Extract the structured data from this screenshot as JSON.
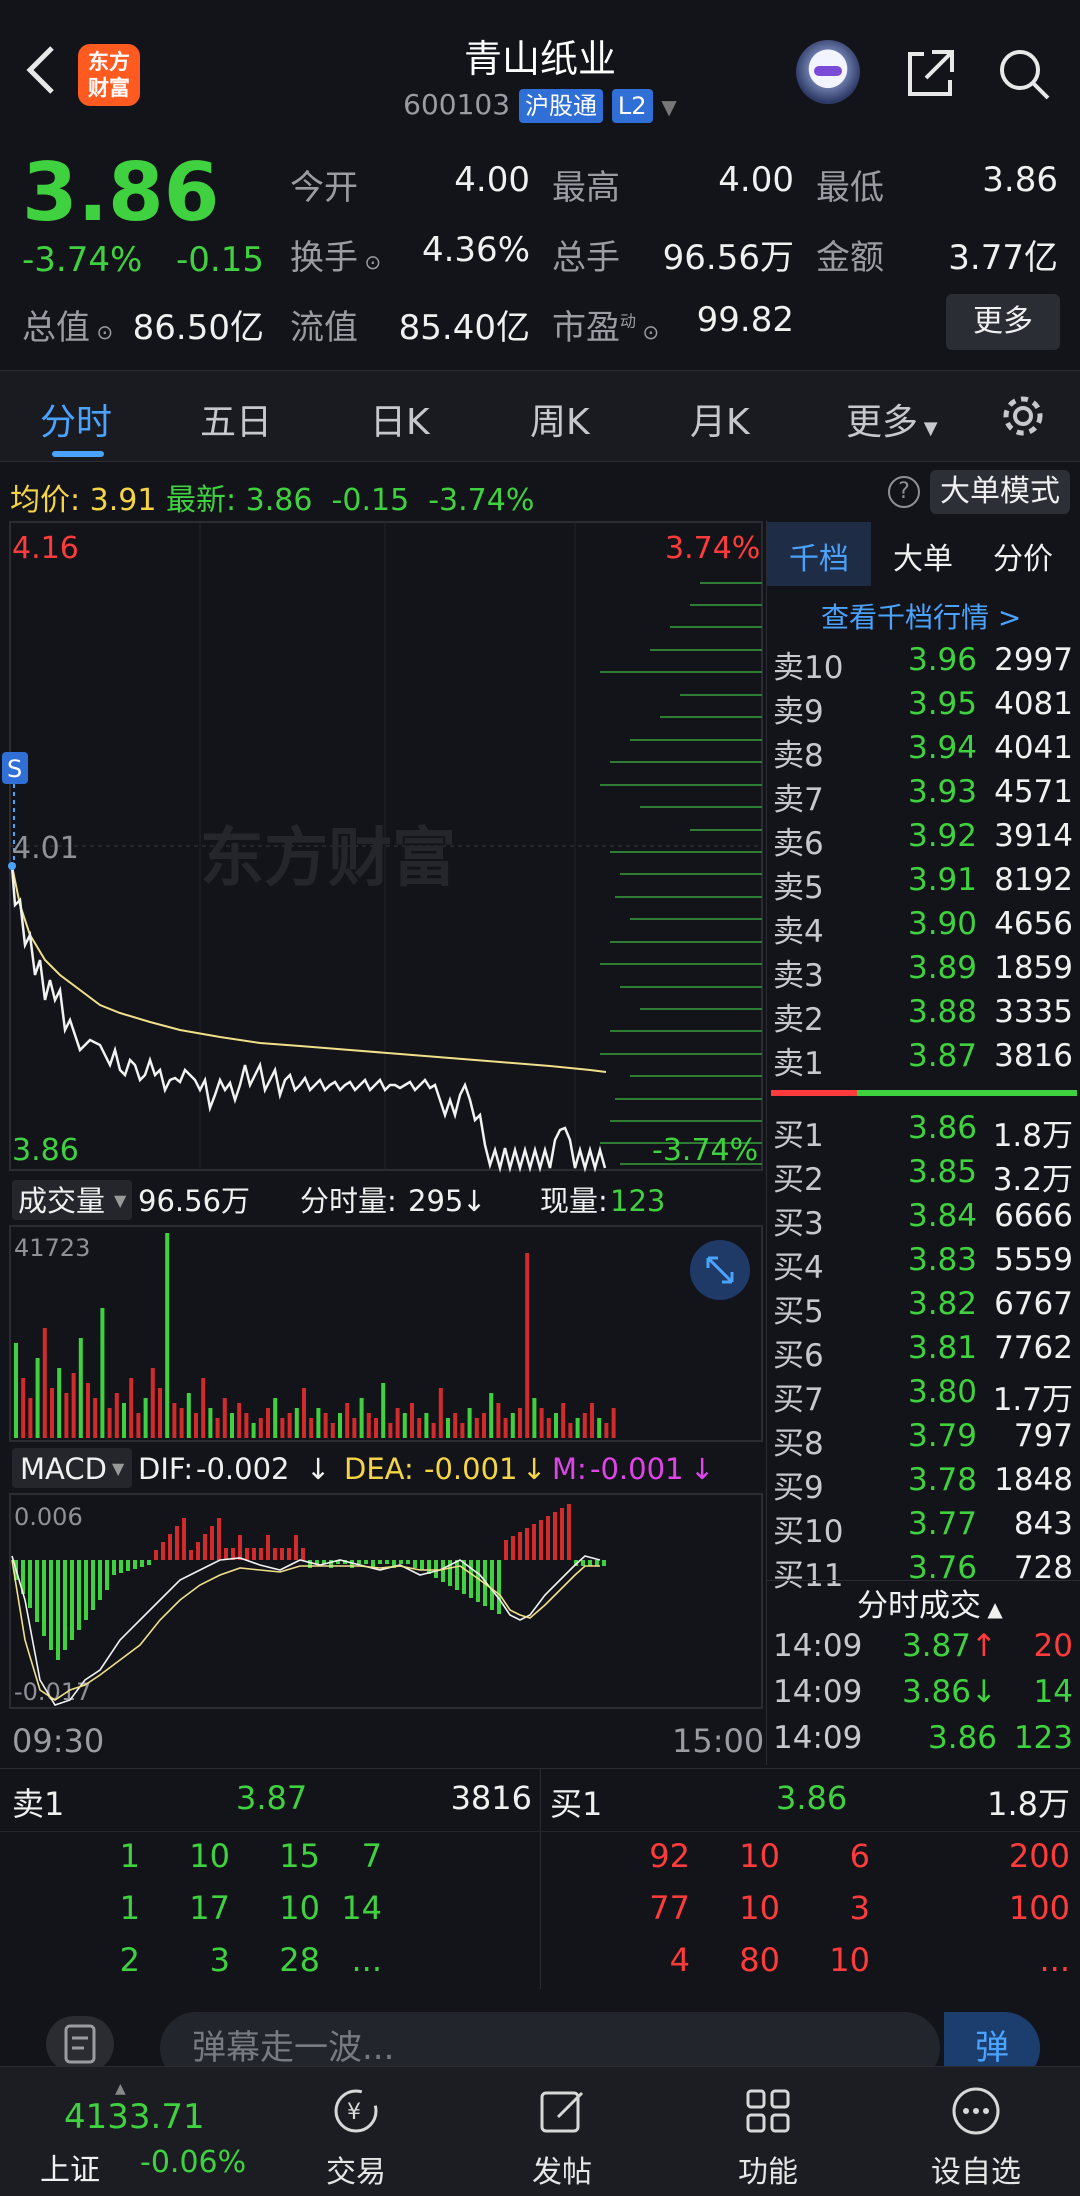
{
  "header": {
    "logo_text": "东方财富",
    "title": "青山纸业",
    "code": "600103",
    "tag_market": "沪股通",
    "tag_level": "L2"
  },
  "quote": {
    "price": "3.86",
    "change_pct": "-3.74%",
    "change": "-0.15",
    "rows": [
      {
        "l1": "今开",
        "v1": "4.00",
        "l2": "最高",
        "v2": "4.00",
        "l3": "最低",
        "v3": "3.86"
      },
      {
        "l1": "换手",
        "v1": "4.36%",
        "l2": "总手",
        "v2": "96.56万",
        "l3": "金额",
        "v3": "3.77亿"
      },
      {
        "l1": "总值",
        "v1": "86.50亿",
        "l2": "流值",
        "v2": "85.40亿",
        "l3": "市盈",
        "v3": "99.82"
      }
    ],
    "pe_sup": "动",
    "more_label": "更多"
  },
  "tabs": [
    "分时",
    "五日",
    "日K",
    "周K",
    "月K",
    "更多"
  ],
  "info": {
    "avg_label": "均价:",
    "avg": "3.91",
    "latest_label": "最新:",
    "latest": "3.86",
    "chg": "-0.15",
    "pct": "-3.74%",
    "mode_label": "大单模式"
  },
  "chart": {
    "hi": "4.16",
    "hi_pct": "3.74%",
    "mid": "4.01",
    "lo": "3.86",
    "lo_pct": "-3.74%",
    "watermark": "东方财富",
    "s_marker": "S",
    "vol_label": "成交量",
    "vol_total": "96.56万",
    "tick_vol_label": "分时量:",
    "tick_vol": "295",
    "cur_vol_label": "现量:",
    "cur_vol": "123",
    "vol_max": "41723",
    "macd_label": "MACD",
    "dif_label": "DIF:",
    "dif": "-0.002",
    "dea_label": "DEA:",
    "dea": "-0.001",
    "m_label": "M:",
    "m": "-0.001",
    "macd_hi": "0.006",
    "macd_lo": "-0.017",
    "time_start": "09:30",
    "time_end": "15:00"
  },
  "orderbook": {
    "tabs": [
      "千档",
      "大单",
      "分价"
    ],
    "link": "查看千档行情 >",
    "asks": [
      {
        "l": "卖10",
        "p": "3.96",
        "v": "2997"
      },
      {
        "l": "卖9",
        "p": "3.95",
        "v": "4081"
      },
      {
        "l": "卖8",
        "p": "3.94",
        "v": "4041"
      },
      {
        "l": "卖7",
        "p": "3.93",
        "v": "4571"
      },
      {
        "l": "卖6",
        "p": "3.92",
        "v": "3914"
      },
      {
        "l": "卖5",
        "p": "3.91",
        "v": "8192"
      },
      {
        "l": "卖4",
        "p": "3.90",
        "v": "4656"
      },
      {
        "l": "卖3",
        "p": "3.89",
        "v": "1859"
      },
      {
        "l": "卖2",
        "p": "3.88",
        "v": "3335"
      },
      {
        "l": "卖1",
        "p": "3.87",
        "v": "3816"
      }
    ],
    "bids": [
      {
        "l": "买1",
        "p": "3.86",
        "v": "1.8万"
      },
      {
        "l": "买2",
        "p": "3.85",
        "v": "3.2万"
      },
      {
        "l": "买3",
        "p": "3.84",
        "v": "6666"
      },
      {
        "l": "买4",
        "p": "3.83",
        "v": "5559"
      },
      {
        "l": "买5",
        "p": "3.82",
        "v": "6767"
      },
      {
        "l": "买6",
        "p": "3.81",
        "v": "7762"
      },
      {
        "l": "买7",
        "p": "3.80",
        "v": "1.7万"
      },
      {
        "l": "买8",
        "p": "3.79",
        "v": "797"
      },
      {
        "l": "买9",
        "p": "3.78",
        "v": "1848"
      },
      {
        "l": "买10",
        "p": "3.77",
        "v": "843"
      },
      {
        "l": "买11",
        "p": "3.76",
        "v": "728"
      }
    ],
    "trades_label": "分时成交",
    "trades": [
      {
        "t": "14:09",
        "p": "3.87",
        "dir": "↑",
        "v": "20",
        "color": "red"
      },
      {
        "t": "14:09",
        "p": "3.86",
        "dir": "↓",
        "v": "14",
        "color": "green"
      },
      {
        "t": "14:09",
        "p": "3.86",
        "dir": "",
        "v": "123",
        "color": "green"
      }
    ]
  },
  "quickbook": {
    "sell_label": "卖1",
    "sell_price": "3.87",
    "sell_vol": "3816",
    "buy_label": "买1",
    "buy_price": "3.86",
    "buy_vol": "1.8万",
    "sell_rows": [
      [
        "1",
        "10",
        "15",
        "7"
      ],
      [
        "1",
        "17",
        "10",
        "14"
      ],
      [
        "2",
        "3",
        "28",
        "..."
      ]
    ],
    "buy_rows": [
      [
        "92",
        "10",
        "6",
        "200"
      ],
      [
        "77",
        "10",
        "3",
        "100"
      ],
      [
        "4",
        "80",
        "10",
        "..."
      ]
    ]
  },
  "comment": {
    "placeholder": "弹幕走一波...",
    "danmu": "弹"
  },
  "nav": {
    "index_value": "4133.71",
    "index_name": "上证",
    "index_pct": "-0.06%",
    "items": [
      "交易",
      "发帖",
      "功能",
      "设自选"
    ]
  }
}
